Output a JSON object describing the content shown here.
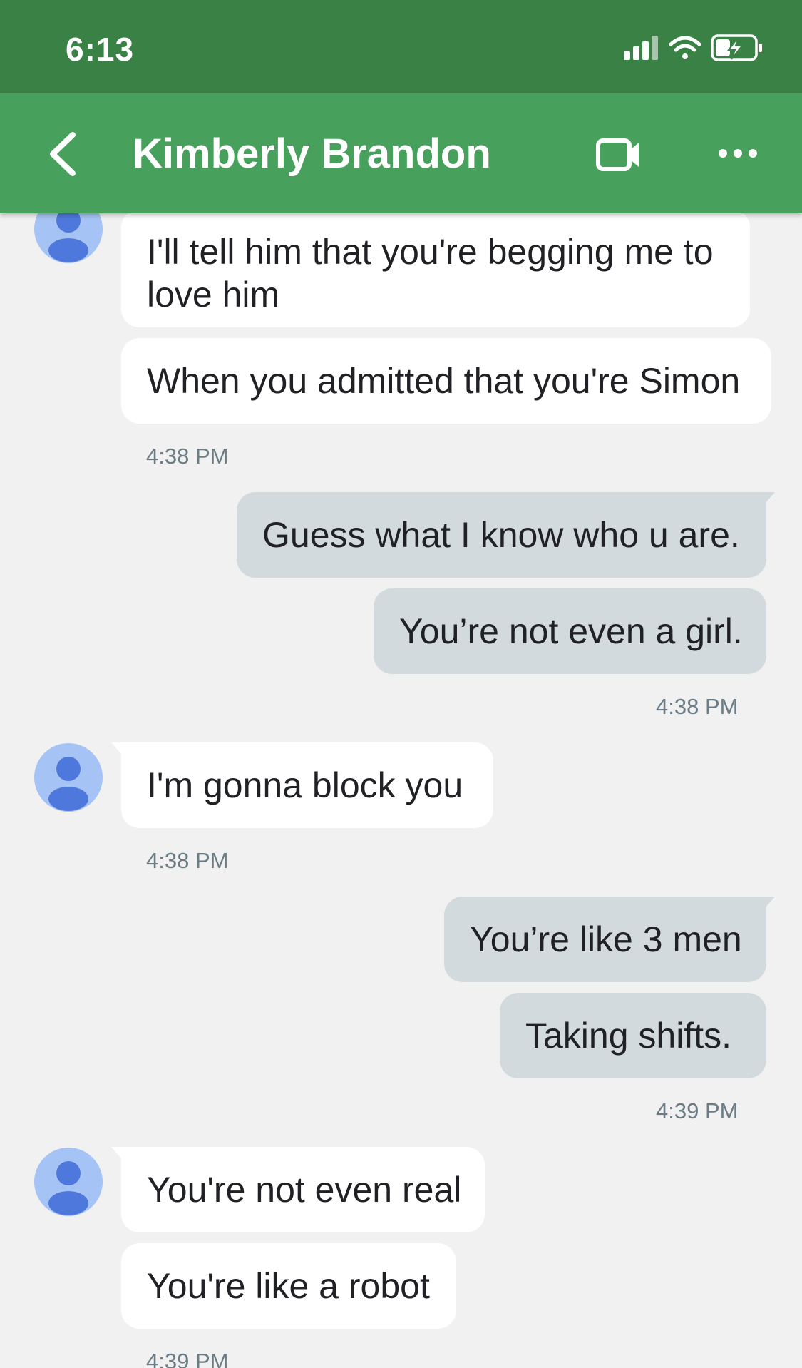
{
  "status_bar": {
    "time": "6:13",
    "icons": [
      "signal-icon",
      "wifi-icon",
      "battery-charging-icon"
    ]
  },
  "header": {
    "contact_name": "Kimberly Brandon",
    "back_icon": "chevron-left-icon",
    "video_icon": "video-camera-icon",
    "more_icon": "more-horizontal-icon"
  },
  "colors": {
    "status_bar": "#3a8145",
    "app_bar": "#47a05c",
    "background": "#f1f1f1",
    "incoming_bubble": "#ffffff",
    "outgoing_bubble": "#d3dadd",
    "avatar": "#a5c3f4",
    "avatar_figure": "#4f78dc"
  },
  "messages": [
    {
      "direction": "incoming",
      "lines": [
        "I'll tell him that you're begging me to",
        "love him"
      ]
    },
    {
      "direction": "incoming",
      "text": "When you admitted that you're Simon"
    },
    {
      "timestamp": "4:38 PM"
    },
    {
      "direction": "outgoing",
      "text": "Guess what I know who u are."
    },
    {
      "direction": "outgoing",
      "text": "You’re not even a girl."
    },
    {
      "timestamp": "4:38 PM"
    },
    {
      "direction": "incoming",
      "text": "I'm gonna block you"
    },
    {
      "timestamp": "4:38 PM"
    },
    {
      "direction": "outgoing",
      "text": "You’re like 3 men"
    },
    {
      "direction": "outgoing",
      "text": "Taking shifts."
    },
    {
      "timestamp": "4:39 PM"
    },
    {
      "direction": "incoming",
      "text": "You're not even real"
    },
    {
      "direction": "incoming",
      "text": "You're like a robot"
    },
    {
      "timestamp": "4:39 PM"
    }
  ]
}
